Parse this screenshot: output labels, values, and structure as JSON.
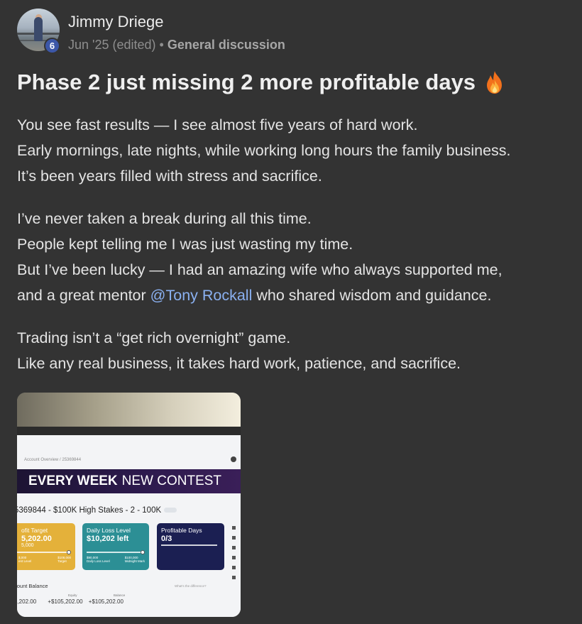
{
  "post": {
    "author": "Jimmy Driege",
    "avatar_badge": "6",
    "date": "Jun '25 (edited)",
    "separator": "•",
    "category": "General discussion",
    "title": "Phase 2 just missing 2 more profitable days",
    "title_icon": "fire-icon",
    "paragraphs": [
      {
        "lines": [
          "You see fast results — I see almost five years of hard work.",
          "Early mornings, late nights, while working long hours the family business.",
          "It’s been years filled with stress and sacrifice."
        ]
      },
      {
        "lines": [
          "I’ve never taken a break during all this time.",
          "People kept telling me I was just wasting my time.",
          "But I’ve been lucky — I had an amazing wife who always supported me,"
        ],
        "mention_line": {
          "before": "and a great mentor ",
          "mention": "@Tony Rockall",
          "after": " who shared wisdom and guidance."
        }
      },
      {
        "lines": [
          "Trading isn’t a “get rich overnight” game.",
          "Like any real business, it takes hard work, patience, and sacrifice."
        ]
      }
    ],
    "mention_color": "#8ab0f0"
  },
  "photo": {
    "breadcrumb": "Account Overview / 25369844",
    "banner_bold": "EVERY WEEK",
    "banner_rest": "NEW CONTEST",
    "account_line": "5369844 - $100K High Stakes - 2 - 100K",
    "cards": {
      "profit": {
        "label": "ofit Target",
        "value": "5,202.00",
        "sub": "5,000",
        "foot_left": "$,000",
        "foot_left_sub": "ent Level",
        "foot_right": "$108,000",
        "foot_right_sub": "Target"
      },
      "loss": {
        "label": "Daily Loss Level",
        "value": "$10,202 left",
        "foot_left": "$90,000",
        "foot_left_sub": "Daily Loss Level",
        "foot_right": "$100,000",
        "foot_right_sub": "Midnight Mark"
      },
      "days": {
        "label": "Profitable Days",
        "value": "0/3"
      }
    },
    "balance_label": "count Balance",
    "balance_info": "What's the difference?",
    "balance_value": "5,202.00",
    "equity_label": "Equity",
    "equity_value": "+$105,202.00",
    "balance2_label": "Balance",
    "balance2_value": "+$105,202.00"
  },
  "colors": {
    "background": "#333333",
    "badge": "#3c57a8",
    "card_gold": "#e4b13a",
    "card_teal": "#2c8f95",
    "card_navy": "#1b1f52"
  }
}
